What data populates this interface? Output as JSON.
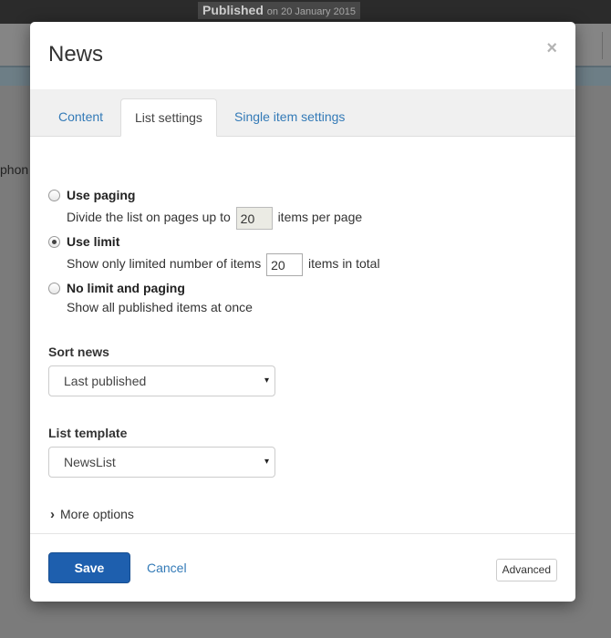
{
  "background": {
    "published_label": "Published",
    "published_date": "on 20 January 2015",
    "partial_text": "phon"
  },
  "modal": {
    "title": "News",
    "close_symbol": "×",
    "tabs": [
      {
        "label": "Content",
        "active": false
      },
      {
        "label": "List settings",
        "active": true
      },
      {
        "label": "Single item settings",
        "active": false
      }
    ],
    "options": {
      "use_paging": {
        "label": "Use paging",
        "checked": false,
        "desc_before": "Divide the list on pages up to",
        "value": "20",
        "desc_after": "items per page"
      },
      "use_limit": {
        "label": "Use limit",
        "checked": true,
        "desc_before": "Show only limited number of items",
        "value": "20",
        "desc_after": "items in total"
      },
      "no_limit": {
        "label": "No limit and paging",
        "checked": false,
        "desc": "Show all published items at once"
      }
    },
    "sort": {
      "label": "Sort news",
      "selected": "Last published"
    },
    "template": {
      "label": "List template",
      "selected": "NewsList"
    },
    "more_options": "More options",
    "footer": {
      "save": "Save",
      "cancel": "Cancel",
      "advanced": "Advanced"
    }
  },
  "icons": {
    "dropdown_arrow": "▾",
    "chevron": "›"
  },
  "colors": {
    "primary": "#1e5fae",
    "link": "#337ab7"
  }
}
